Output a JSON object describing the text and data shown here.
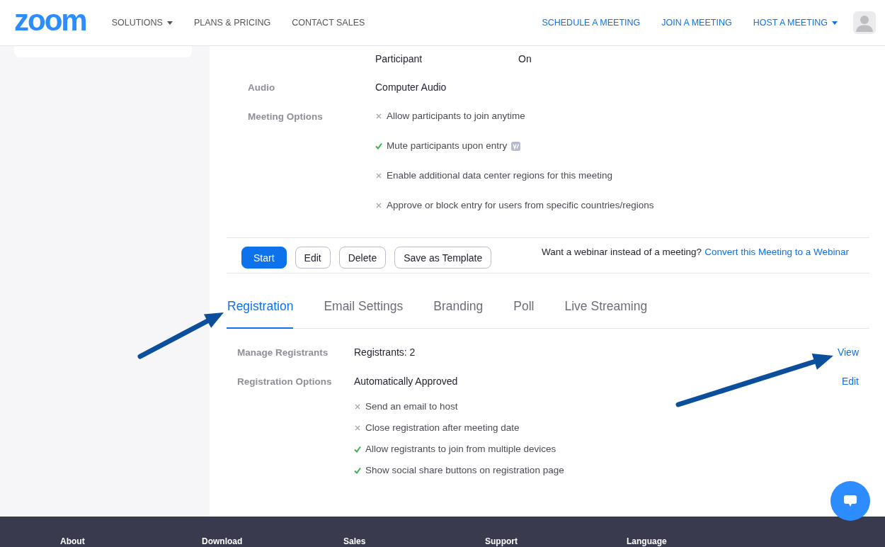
{
  "header": {
    "logo": "zoom",
    "nav_left": [
      {
        "label": "SOLUTIONS",
        "dropdown": true
      },
      {
        "label": "PLANS & PRICING",
        "dropdown": false
      },
      {
        "label": "CONTACT SALES",
        "dropdown": false
      }
    ],
    "nav_right": [
      {
        "label": "SCHEDULE A MEETING",
        "dropdown": false
      },
      {
        "label": "JOIN A MEETING",
        "dropdown": false
      },
      {
        "label": "HOST A MEETING",
        "dropdown": true
      }
    ]
  },
  "meeting": {
    "rows": [
      {
        "values": [
          "Participant",
          "On"
        ]
      },
      {
        "label": "Audio",
        "values": [
          "Computer Audio"
        ]
      },
      {
        "label": "Meeting Options",
        "options": [
          {
            "text": "Allow participants to join anytime",
            "checked": false,
            "tag": false
          },
          {
            "text": "Mute participants upon entry",
            "checked": true,
            "tag": true
          },
          {
            "text": "Enable additional data center regions for this meeting",
            "checked": false,
            "tag": false
          },
          {
            "text": "Approve or block entry for users from specific countries/regions",
            "checked": false,
            "tag": false
          }
        ]
      }
    ]
  },
  "actions": {
    "buttons": [
      {
        "label": "Start",
        "primary": true
      },
      {
        "label": "Edit",
        "primary": false
      },
      {
        "label": "Delete",
        "primary": false
      },
      {
        "label": "Save as Template",
        "primary": false
      }
    ],
    "prompt": "Want a webinar instead of a meeting?",
    "link": "Convert this Meeting to a Webinar"
  },
  "tabs": [
    {
      "label": "Registration",
      "selected": true
    },
    {
      "label": "Email Settings",
      "selected": false
    },
    {
      "label": "Branding",
      "selected": false
    },
    {
      "label": "Poll",
      "selected": false
    },
    {
      "label": "Live Streaming",
      "selected": false
    }
  ],
  "registration": {
    "rows": [
      {
        "label": "Manage Registrants",
        "value": "Registrants: 2",
        "link": "View"
      },
      {
        "label": "Registration Options",
        "value": "Automatically Approved",
        "link": "Edit",
        "options": [
          {
            "text": "Send an email to host",
            "checked": false
          },
          {
            "text": "Close registration after meeting date",
            "checked": false
          },
          {
            "text": "Allow registrants to join from multiple devices",
            "checked": true
          },
          {
            "text": "Show social share buttons on registration page",
            "checked": true
          }
        ]
      }
    ]
  },
  "footer": {
    "headings": [
      "About",
      "Download",
      "Sales",
      "Support",
      "Language"
    ]
  }
}
